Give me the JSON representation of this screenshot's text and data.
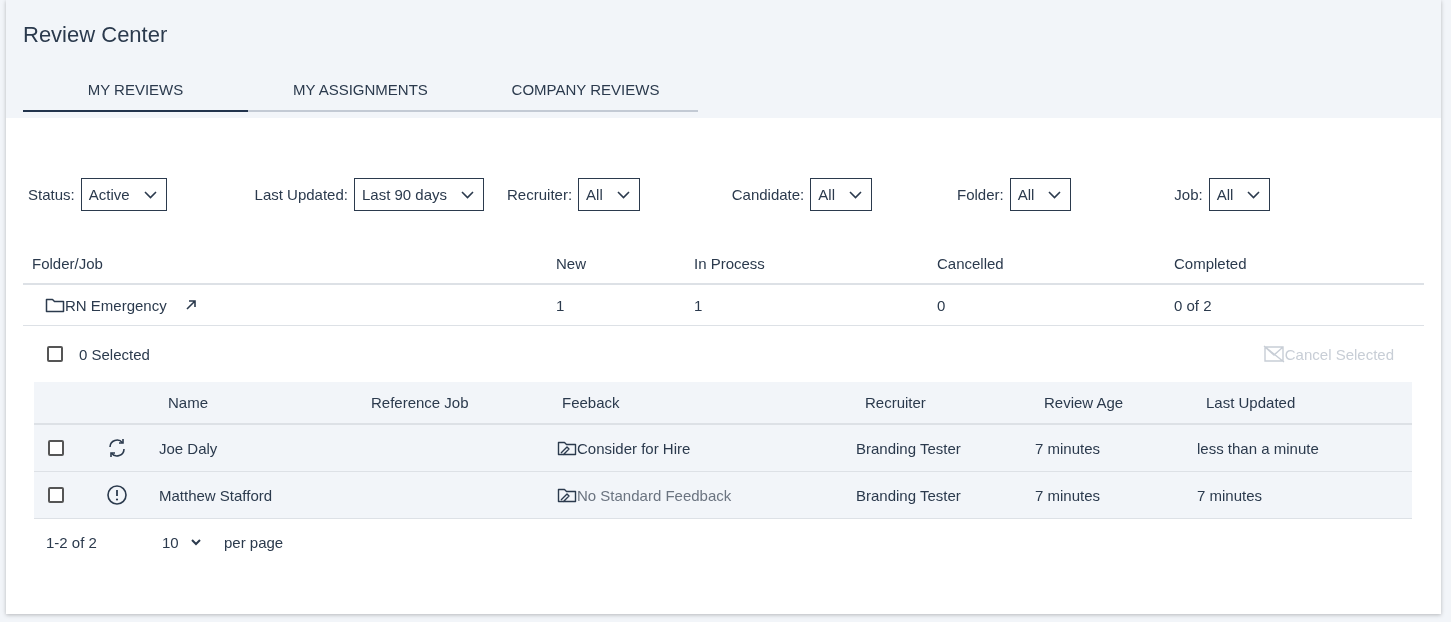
{
  "title": "Review Center",
  "tabs": [
    {
      "label": "MY REVIEWS",
      "selected": true
    },
    {
      "label": "MY ASSIGNMENTS",
      "selected": false
    },
    {
      "label": "COMPANY REVIEWS",
      "selected": false
    }
  ],
  "filters": [
    {
      "label": "Status:",
      "value": "Active"
    },
    {
      "label": "Last Updated:",
      "value": "Last 90 days"
    },
    {
      "label": "Recruiter:",
      "value": "All"
    },
    {
      "label": "Candidate:",
      "value": "All"
    },
    {
      "label": "Folder:",
      "value": "All"
    },
    {
      "label": "Job:",
      "value": "All"
    }
  ],
  "folder_table": {
    "columns": [
      "Folder/Job",
      "New",
      "In Process",
      "Cancelled",
      "Completed"
    ],
    "rows": [
      {
        "name": "RN Emergency",
        "new": "1",
        "in_process": "1",
        "cancelled": "0",
        "completed": "0 of 2"
      }
    ]
  },
  "selection": {
    "checked": false,
    "label": "0 Selected",
    "action": "Cancel Selected",
    "action_disabled": true
  },
  "reviews": {
    "columns": [
      "Name",
      "Reference Job",
      "Feeback",
      "Recruiter",
      "Review Age",
      "Last Updated"
    ],
    "rows": [
      {
        "checked": false,
        "kind": "refresh",
        "name": "Joe Daly",
        "feedback": "Consider for Hire",
        "feedback_muted": false,
        "recruiter": "Branding Tester",
        "review_age": "7 minutes",
        "last_updated": "less than a minute"
      },
      {
        "checked": false,
        "kind": "alert",
        "name": "Matthew Stafford",
        "feedback": "No Standard Feedback",
        "feedback_muted": true,
        "recruiter": "Branding Tester",
        "review_age": "7 minutes",
        "last_updated": "7 minutes"
      }
    ]
  },
  "pagination": {
    "range": "1-2 of 2",
    "per_page_value": "10",
    "per_page_label": "per page"
  }
}
